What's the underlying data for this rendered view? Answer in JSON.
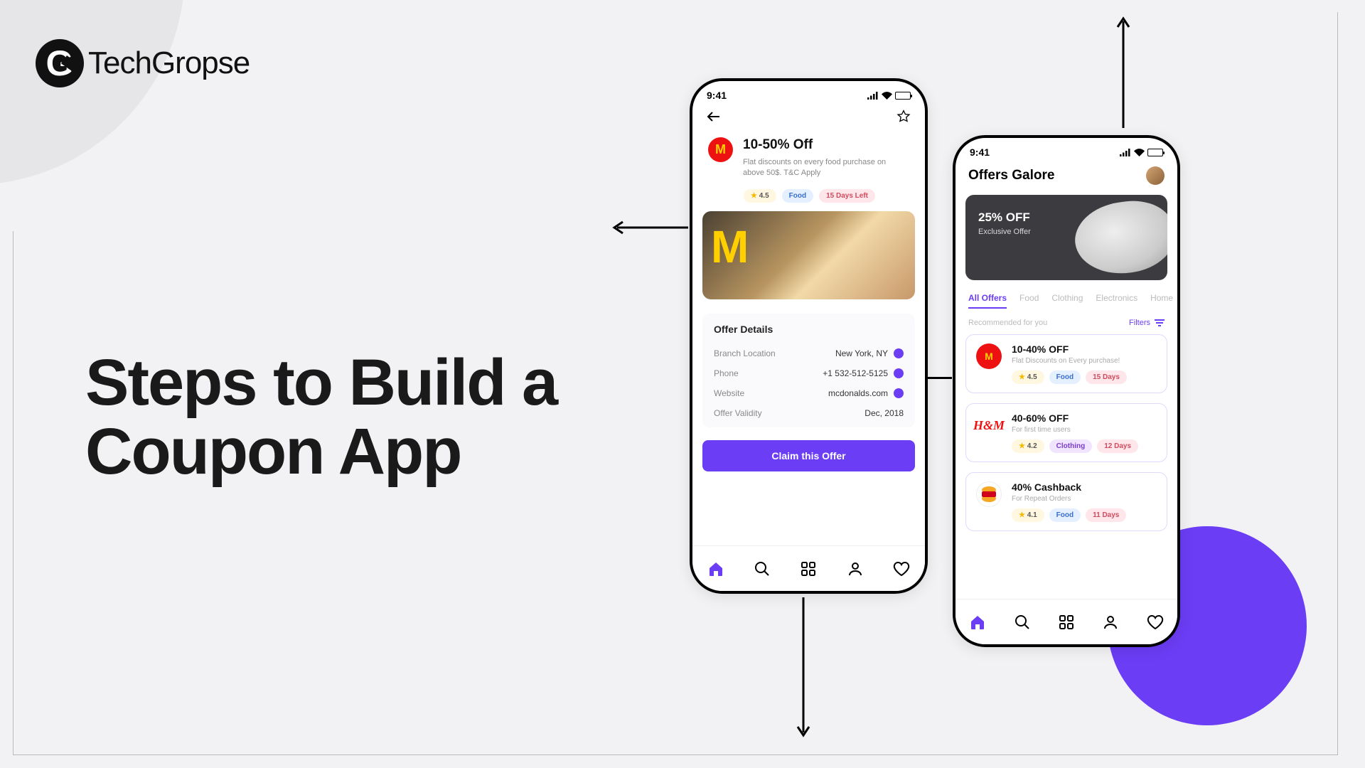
{
  "brand": "TechGropse",
  "headline_line1": "Steps to Build a",
  "headline_line2": "Coupon App",
  "phone1": {
    "time": "9:41",
    "brand_letter": "M",
    "offer_title": "10-50% Off",
    "offer_sub": "Flat discounts on every food purchase on above 50$. T&C Apply",
    "rating": "4.5",
    "category_chip": "Food",
    "expiry_chip": "15 Days Left",
    "details_heading": "Offer Details",
    "rows": [
      {
        "label": "Branch Location",
        "value": "New York, NY"
      },
      {
        "label": "Phone",
        "value": "+1 532-512-5125"
      },
      {
        "label": "Website",
        "value": "mcdonalds.com"
      },
      {
        "label": "Offer Validity",
        "value": "Dec, 2018"
      }
    ],
    "cta": "Claim this Offer"
  },
  "phone2": {
    "time": "9:41",
    "header": "Offers Galore",
    "banner_title": "25% OFF",
    "banner_sub": "Exclusive Offer",
    "tabs": [
      "All Offers",
      "Food",
      "Clothing",
      "Electronics",
      "Home"
    ],
    "recommended": "Recommended for you",
    "filters_label": "Filters",
    "cards": [
      {
        "title": "10-40% OFF",
        "sub": "Flat Discounts on Every purchase!",
        "rating": "4.5",
        "cat": "Food",
        "days": "15 Days",
        "logo": "mcd"
      },
      {
        "title": "40-60% OFF",
        "sub": "For first time users",
        "rating": "4.2",
        "cat": "Clothing",
        "days": "12 Days",
        "logo": "hm"
      },
      {
        "title": "40% Cashback",
        "sub": "For Repeat Orders",
        "rating": "4.1",
        "cat": "Food",
        "days": "11 Days",
        "logo": "bk"
      }
    ]
  }
}
